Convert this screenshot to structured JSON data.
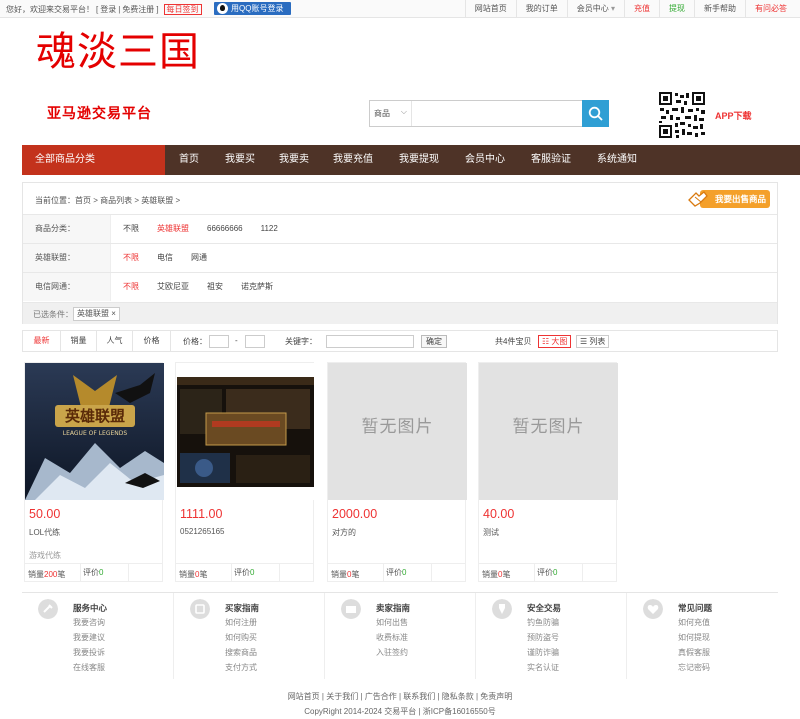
{
  "topbar": {
    "greeting": "您好，欢迎来交易平台！",
    "login": "登录",
    "register": "免费注册",
    "daily": "每日签到",
    "qq_login": "用QQ账号登录",
    "nav": [
      "网站首页",
      "我的订单",
      "会员中心",
      "充值",
      "提现",
      "新手帮助",
      "有问必答"
    ]
  },
  "logo": "魂淡三国",
  "slogan": "亚马逊交易平台",
  "search": {
    "category": "商品",
    "placeholder": ""
  },
  "app_label": "APP下载",
  "navbar": {
    "all": "全部商品分类",
    "items": [
      "首页",
      "我要买",
      "我要卖",
      "我要充值",
      "我要提现",
      "会员中心",
      "客服验证",
      "系统通知"
    ]
  },
  "breadcrumb": "当前位置：首页 > 商品列表 > 英雄联盟 >",
  "sell_button": "我要出售商品",
  "filters": [
    {
      "label": "商品分类：",
      "options": [
        "不限",
        "英雄联盟",
        "66666666",
        "1122"
      ],
      "selected": 1
    },
    {
      "label": "英雄联盟：",
      "options": [
        "不限",
        "电信",
        "网通"
      ],
      "selected": 0
    },
    {
      "label": "电信网通：",
      "options": [
        "不限",
        "艾欧尼亚",
        "祖安",
        "诺克萨斯"
      ],
      "selected": 0
    }
  ],
  "selected_conditions": {
    "label": "已选条件：",
    "tag": "英雄联盟 ×"
  },
  "sortbar": {
    "latest": "最新",
    "sales": "销量",
    "popularity": "人气",
    "price": "价格",
    "price_label": "价格：",
    "dash": "-",
    "keyword_label": "关键字：",
    "confirm": "确定",
    "total": "共4件宝贝",
    "big": "☷ 大图",
    "list": "☰ 列表"
  },
  "products": [
    {
      "price": "50.00",
      "title": "LOL代练",
      "category": "游戏代练",
      "sales_label": "销量",
      "sales": "200",
      "sales_unit": "笔",
      "rating_label": "评价",
      "rating": "0",
      "image": "lol-logo"
    },
    {
      "price": "1111.00",
      "title": "0521265165",
      "category": "",
      "sales_label": "销量",
      "sales": "0",
      "sales_unit": "笔",
      "rating_label": "评价",
      "rating": "0",
      "image": "game-screenshot"
    },
    {
      "price": "2000.00",
      "title": "对方的",
      "category": "",
      "sales_label": "销量",
      "sales": "0",
      "sales_unit": "笔",
      "rating_label": "评价",
      "rating": "0",
      "image": "暂无图片"
    },
    {
      "price": "40.00",
      "title": "测试",
      "category": "",
      "sales_label": "销量",
      "sales": "0",
      "sales_unit": "笔",
      "rating_label": "评价",
      "rating": "0",
      "image": "暂无图片"
    }
  ],
  "footer_cols": [
    {
      "title": "服务中心",
      "links": [
        "我要咨询",
        "我要建议",
        "我要投诉",
        "在线客服"
      ],
      "icon": "service-icon"
    },
    {
      "title": "买家指南",
      "links": [
        "如何注册",
        "如何购买",
        "搜索商品",
        "支付方式"
      ],
      "icon": "buyer-icon"
    },
    {
      "title": "卖家指南",
      "links": [
        "如何出售",
        "收费标准",
        "入驻签约"
      ],
      "icon": "seller-icon"
    },
    {
      "title": "安全交易",
      "links": [
        "钓鱼防骗",
        "预防盗号",
        "谨防诈骗",
        "实名认证"
      ],
      "icon": "security-icon"
    },
    {
      "title": "常见问题",
      "links": [
        "如何充值",
        "如何提现",
        "真假客服",
        "忘记密码"
      ],
      "icon": "faq-icon"
    }
  ],
  "footer_links": "网站首页 | 关于我们 | 广告合作 | 联系我们 | 隐私条款 | 免责声明",
  "copyright": "CopyRight 2014-2024 交易平台 | 浙ICP备16016550号"
}
